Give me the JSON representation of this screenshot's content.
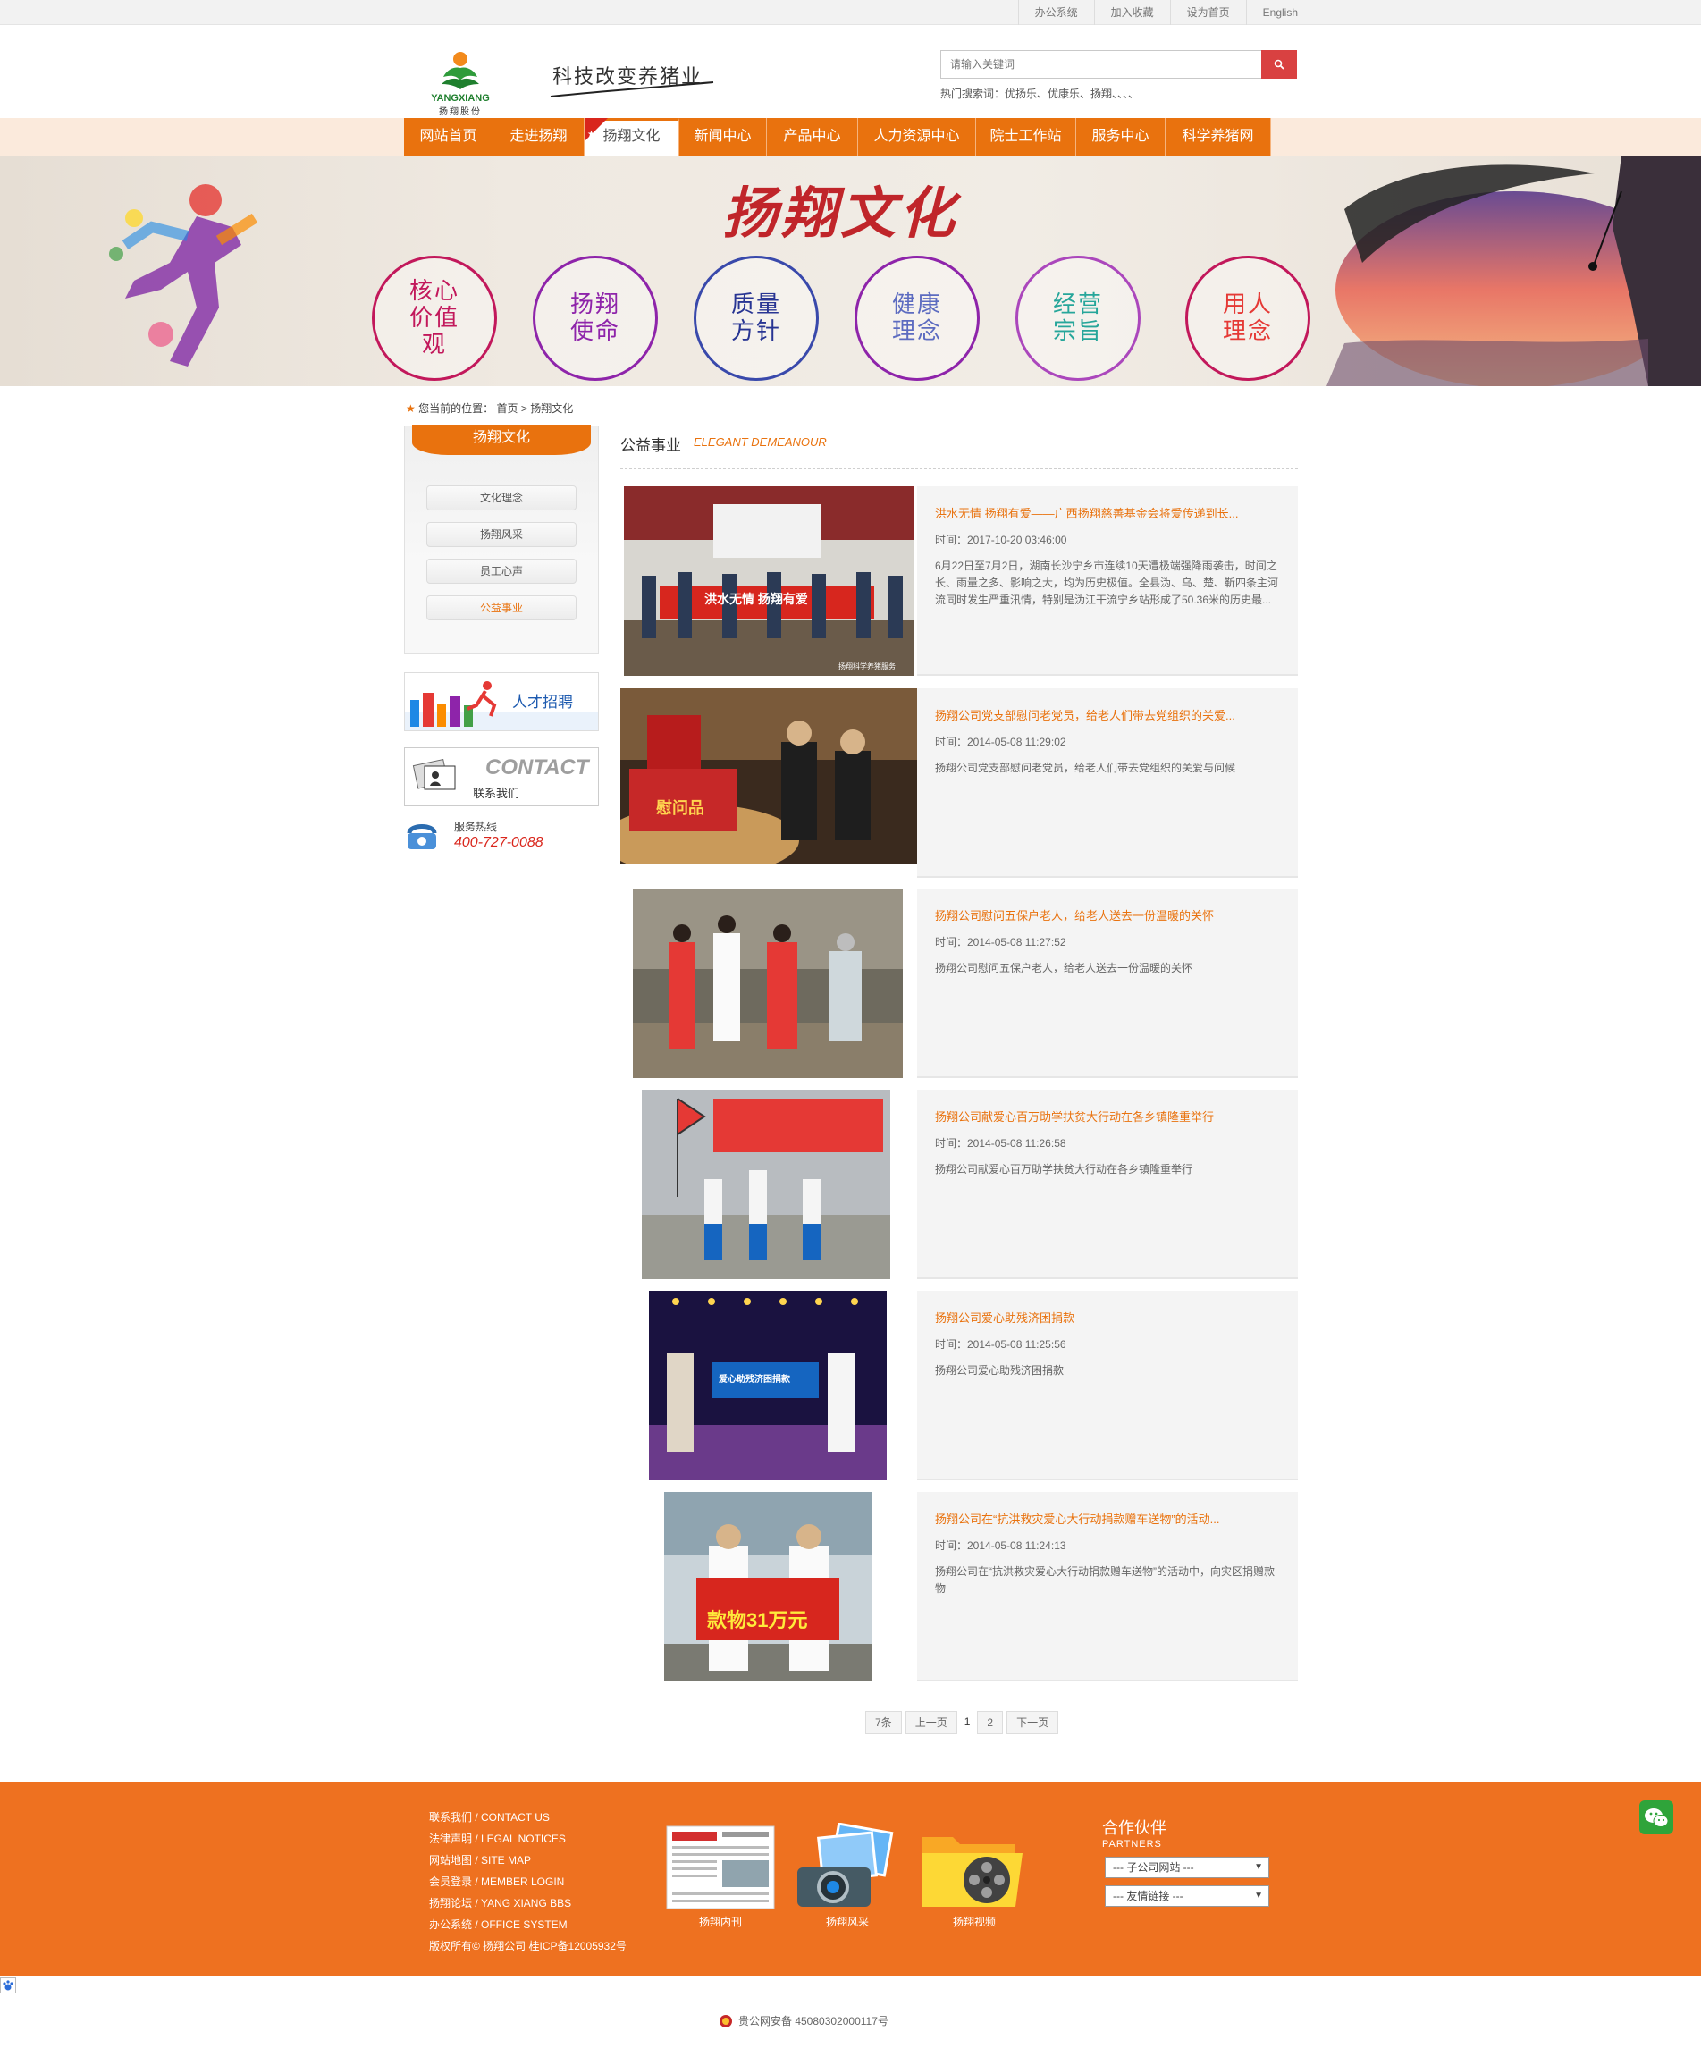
{
  "topbar": {
    "links": [
      "办公系统",
      "加入收藏",
      "设为首页",
      "English"
    ]
  },
  "header": {
    "logo_en": "YANGXIANG",
    "logo_cn": "扬翔股份",
    "slogan": "科技改变养猪业",
    "search_placeholder": "请输入关键词",
    "hotwords": "热门搜索词：优扬乐、优康乐、扬翔、、、、"
  },
  "nav": [
    "网站首页",
    "走进扬翔",
    "扬翔文化",
    "新闻中心",
    "产品中心",
    "人力资源中心",
    "院士工作站",
    "服务中心",
    "科学养猪网"
  ],
  "banner": {
    "title": "扬翔文化",
    "circles": [
      {
        "text": "核心价值观",
        "color": "#c2185b"
      },
      {
        "text": "扬翔使命",
        "color": "#8e24aa"
      },
      {
        "text": "质量方针",
        "color": "#283593"
      },
      {
        "text": "健康理念",
        "color": "#5c6bc0"
      },
      {
        "text": "经营宗旨",
        "color": "#26a69a"
      },
      {
        "text": "用人理念",
        "color": "#e53935"
      }
    ]
  },
  "breadcrumb": {
    "prefix": "您当前的位置：",
    "home": "首页",
    "sep": ">",
    "current": "扬翔文化"
  },
  "sidebar": {
    "title": "扬翔文化",
    "items": [
      "文化理念",
      "扬翔风采",
      "员工心声",
      "公益事业"
    ],
    "recruit": "人才招聘",
    "contact_en": "CONTACT",
    "contact_cn": "联系我们",
    "hotline_label": "服务热线",
    "hotline_number": "400-727-0088"
  },
  "main": {
    "section_title": "公益事业",
    "section_sub": "ELEGANT DEMEANOUR",
    "items": [
      {
        "title": "洪水无情 扬翔有爱——广西扬翔慈善基金会将爱传递到长...",
        "time": "时间：2017-10-20 03:46:00",
        "desc": "6月22日至7月2日，湖南长沙宁乡市连续10天遭极端强降雨袭击，时间之长、雨量之多、影响之大，均为历史极值。全县沩、乌、楚、靳四条主河流同时发生严重汛情，特别是沩江干流宁乡站形成了50.36米的历史最...",
        "banner": "洪水无情 扬翔有爱",
        "watermark": "扬翔科学养猪服务"
      },
      {
        "title": "扬翔公司党支部慰问老党员，给老人们带去党组织的关爱...",
        "time": "时间：2014-05-08 11:29:02",
        "desc": "扬翔公司党支部慰问老党员，给老人们带去党组织的关爱与问候",
        "banner": "慰问品"
      },
      {
        "title": "扬翔公司慰问五保户老人，给老人送去一份温暖的关怀",
        "time": "时间：2014-05-08 11:27:52",
        "desc": "扬翔公司慰问五保户老人，给老人送去一份温暖的关怀"
      },
      {
        "title": "扬翔公司献爱心百万助学扶贫大行动在各乡镇隆重举行",
        "time": "时间：2014-05-08 11:26:58",
        "desc": "扬翔公司献爱心百万助学扶贫大行动在各乡镇隆重举行"
      },
      {
        "title": "扬翔公司爱心助残济困捐款",
        "time": "时间：2014-05-08 11:25:56",
        "desc": "扬翔公司爱心助残济困捐款",
        "banner": "爱心助残济困捐款"
      },
      {
        "title": "扬翔公司在“抗洪救灾爱心大行动捐款赠车送物”的活动...",
        "time": "时间：2014-05-08 11:24:13",
        "desc": "扬翔公司在“抗洪救灾爱心大行动捐款赠车送物”的活动中，向灾区捐赠款物",
        "banner": "款物31万元"
      }
    ]
  },
  "pager": {
    "total": "7条",
    "prev": "上一页",
    "pages": [
      "1",
      "2"
    ],
    "next": "下一页"
  },
  "footer": {
    "links": [
      "联系我们 / CONTACT US",
      "法律声明 / LEGAL NOTICES",
      "网站地图 / SITE MAP",
      "会员登录 / MEMBER LOGIN",
      "扬翔论坛 / YANG XIANG BBS",
      "办公系统 / OFFICE SYSTEM",
      "版权所有© 扬翔公司 桂ICP备12005932号"
    ],
    "icons": [
      "扬翔内刊",
      "扬翔风采",
      "扬翔视频"
    ],
    "partners_title": "合作伙伴",
    "partners_sub": "PARTNERS",
    "select1": "--- 子公司网站 ---",
    "select2": "--- 友情链接 ---"
  },
  "beian": "贵公网安备 45080302000117号",
  "colors": {
    "accent": "#e9720e",
    "footer": "#ee7120",
    "search_btn": "#d94141"
  }
}
